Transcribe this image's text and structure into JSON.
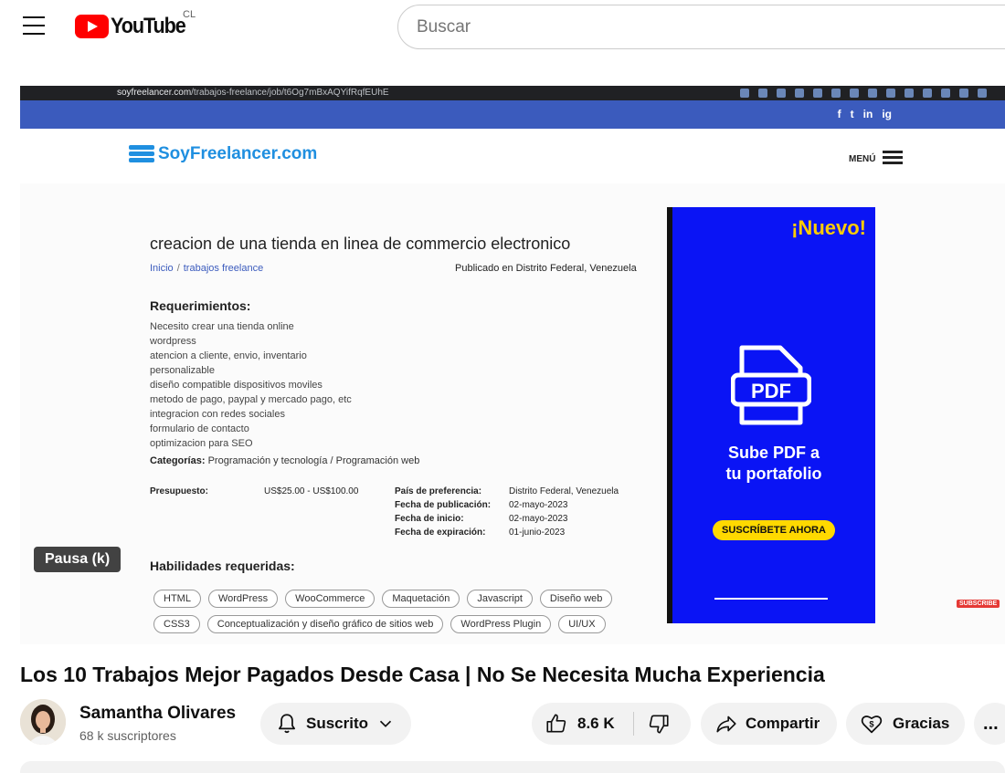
{
  "header": {
    "logo_text": "YouTube",
    "country_code": "CL",
    "search_placeholder": "Buscar"
  },
  "browser": {
    "url_domain": "soyfreelancer.com",
    "url_path": "/trabajos-freelance/job/t6Og7mBxAQYifRqfEUhE"
  },
  "site": {
    "social": [
      "f",
      "t",
      "in",
      "ig"
    ],
    "brand": "SoyFreelancer.com",
    "menu_label": "MENÚ",
    "job_title": "creacion de una tienda en linea de commercio electronico",
    "breadcrumb": [
      "Inicio",
      "trabajos freelance"
    ],
    "published": "Publicado en Distrito Federal, Venezuela",
    "requirements_title": "Requerimientos:",
    "requirements": [
      "Necesito crear una tienda online",
      "wordpress",
      "atencion a cliente, envio, inventario",
      "personalizable",
      "diseño compatible dispositivos moviles",
      "metodo de pago, paypal y mercado pago, etc",
      "integracion con redes sociales",
      "formulario de contacto",
      "optimizacion para SEO"
    ],
    "categories_label": "Categorías:",
    "categories_value": "Programación y tecnología / Programación web",
    "budget_label": "Presupuesto:",
    "budget_value": "US$25.00 - US$100.00",
    "details": [
      {
        "label": "País de preferencia:",
        "value": "Distrito Federal, Venezuela"
      },
      {
        "label": "Fecha de publicación:",
        "value": "02-mayo-2023"
      },
      {
        "label": "Fecha de inicio:",
        "value": "02-mayo-2023"
      },
      {
        "label": "Fecha de expiración:",
        "value": "01-junio-2023"
      }
    ],
    "skills_title": "Habilidades requeridas:",
    "skills": [
      "HTML",
      "WordPress",
      "WooCommerce",
      "Maquetación",
      "Javascript",
      "Diseño web",
      "CSS3",
      "Conceptualización y diseño gráfico de sitios web",
      "WordPress Plugin",
      "UI/UX"
    ]
  },
  "ad": {
    "new_label": "¡Nuevo!",
    "pdf_label": "PDF",
    "text_line1": "Sube PDF a",
    "text_line2": "tu portafolio",
    "button": "SUSCRÍBETE AHORA"
  },
  "player": {
    "pause_tooltip": "Pausa (k)",
    "subscribe_overlay": "SUBSCRIBE"
  },
  "video": {
    "title": "Los 10 Trabajos Mejor Pagados Desde Casa | No Se Necesita Mucha Experiencia",
    "channel_name": "Samantha Olivares",
    "subscribers": "68 k suscriptores",
    "subscribed_label": "Suscrito",
    "likes": "8.6 K",
    "share_label": "Compartir",
    "thanks_label": "Gracias",
    "more_label": "..."
  },
  "colors": {
    "youtube_red": "#ff0000",
    "site_blue": "#3b5bbd",
    "brand_blue": "#1f8fe0",
    "ad_blue": "#0a14f5",
    "ad_yellow": "#ffcc00"
  }
}
